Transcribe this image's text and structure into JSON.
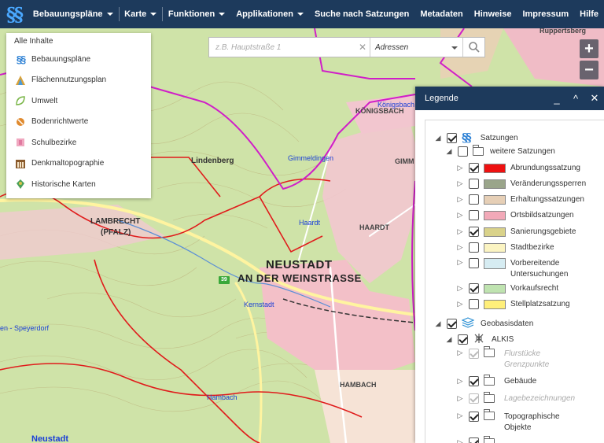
{
  "nav": {
    "logo": "§§",
    "items": [
      {
        "label": "Bebauungspläne",
        "dropdown": true
      },
      {
        "label": "Karte",
        "dropdown": true
      },
      {
        "label": "Funktionen",
        "dropdown": true
      },
      {
        "label": "Applikationen",
        "dropdown": true
      },
      {
        "label": "Suche nach Satzungen",
        "dropdown": false
      },
      {
        "label": "Metadaten",
        "dropdown": false
      },
      {
        "label": "Hinweise",
        "dropdown": false
      },
      {
        "label": "Impressum",
        "dropdown": false
      },
      {
        "label": "Hilfe",
        "dropdown": false
      }
    ]
  },
  "inhalte": {
    "header": "Alle Inhalte",
    "items": [
      {
        "label": "Bebauungspläne",
        "icon": "paragraph-icon",
        "color": "#2a7fd4"
      },
      {
        "label": "Flächennutzungsplan",
        "icon": "landuse-icon",
        "color": "#d9a23a"
      },
      {
        "label": "Umwelt",
        "icon": "leaf-icon",
        "color": "#7ab648"
      },
      {
        "label": "Bodenrichtwerte",
        "icon": "soil-icon",
        "color": "#e08a2e"
      },
      {
        "label": "Schulbezirke",
        "icon": "school-icon",
        "color": "#e07aa0"
      },
      {
        "label": "Denkmaltopographie",
        "icon": "monument-icon",
        "color": "#8a5a2b"
      },
      {
        "label": "Historische Karten",
        "icon": "historic-map-icon",
        "color": "#4aa05a"
      }
    ]
  },
  "search": {
    "placeholder": "z.B. Hauptstraße 1",
    "type": "Adressen"
  },
  "zoom": {
    "in": "+",
    "out": "−"
  },
  "legend": {
    "title": "Legende",
    "controls": {
      "minimize": "_",
      "collapse": "^",
      "close": "✕"
    },
    "rows": [
      {
        "label": "Satzungen",
        "checked": true
      },
      {
        "label": "weitere Satzungen",
        "checked": false
      },
      {
        "label": "Abrundungssatzung",
        "checked": true,
        "swatch": "#ee1111"
      },
      {
        "label": "Veränderungssperren",
        "checked": false,
        "swatch": "#9aa58a"
      },
      {
        "label": "Erhaltungssatzungen",
        "checked": false,
        "swatch": "#e6cfb6"
      },
      {
        "label": "Ortsbildsatzungen",
        "checked": false,
        "swatch": "#f2a9b8"
      },
      {
        "label": "Sanierungsgebiete",
        "checked": true,
        "swatch": "#d9d28a"
      },
      {
        "label": "Stadtbezirke",
        "checked": false,
        "swatch": "#fbf4c2"
      },
      {
        "label": "Vorbereitende",
        "label2": "Untersuchungen",
        "checked": false,
        "swatch": "#d6ecf2"
      },
      {
        "label": "Vorkaufsrecht",
        "checked": true,
        "swatch": "#bfe3b0"
      },
      {
        "label": "Stellplatzsatzung",
        "checked": false,
        "swatch": "#ffef7a"
      },
      {
        "label": "Geobasisdaten",
        "checked": true
      },
      {
        "label": "ALKIS",
        "checked": true
      },
      {
        "label": "Flurstücke",
        "label2": "Grenzpunkte",
        "checked": true,
        "disabled": true
      },
      {
        "label": "Gebäude",
        "checked": true
      },
      {
        "label": "Lagebezeichnungen",
        "checked": true,
        "disabled": true
      },
      {
        "label": "Topographische",
        "label2": "Objekte",
        "checked": true
      }
    ]
  },
  "map_labels": {
    "neustadt_1": "NEUSTADT",
    "neustadt_2": "AN DER WEINSTRASSE",
    "lambrecht_1": "LAMBRECHT",
    "lambrecht_2": "(PFALZ)",
    "lindenberg": "Lindenberg",
    "haardt": "HAARDT",
    "haardt_blue": "Haardt",
    "hambach": "HAMBACH",
    "hambach_blue": "Hambach",
    "gimmeldingen": "Gimmeldingen",
    "koenigsbach": "KÖNIGSBACH",
    "koenigsbach_blue": "Königsbach",
    "speyerdorf": "en - Speyerdorf",
    "kernstadt": "Kernstadt",
    "ruppertsberg": "Ruppertsberg",
    "neustadt_bottom": "Neustadt",
    "gimm": "GIMM",
    "marker": "39"
  }
}
